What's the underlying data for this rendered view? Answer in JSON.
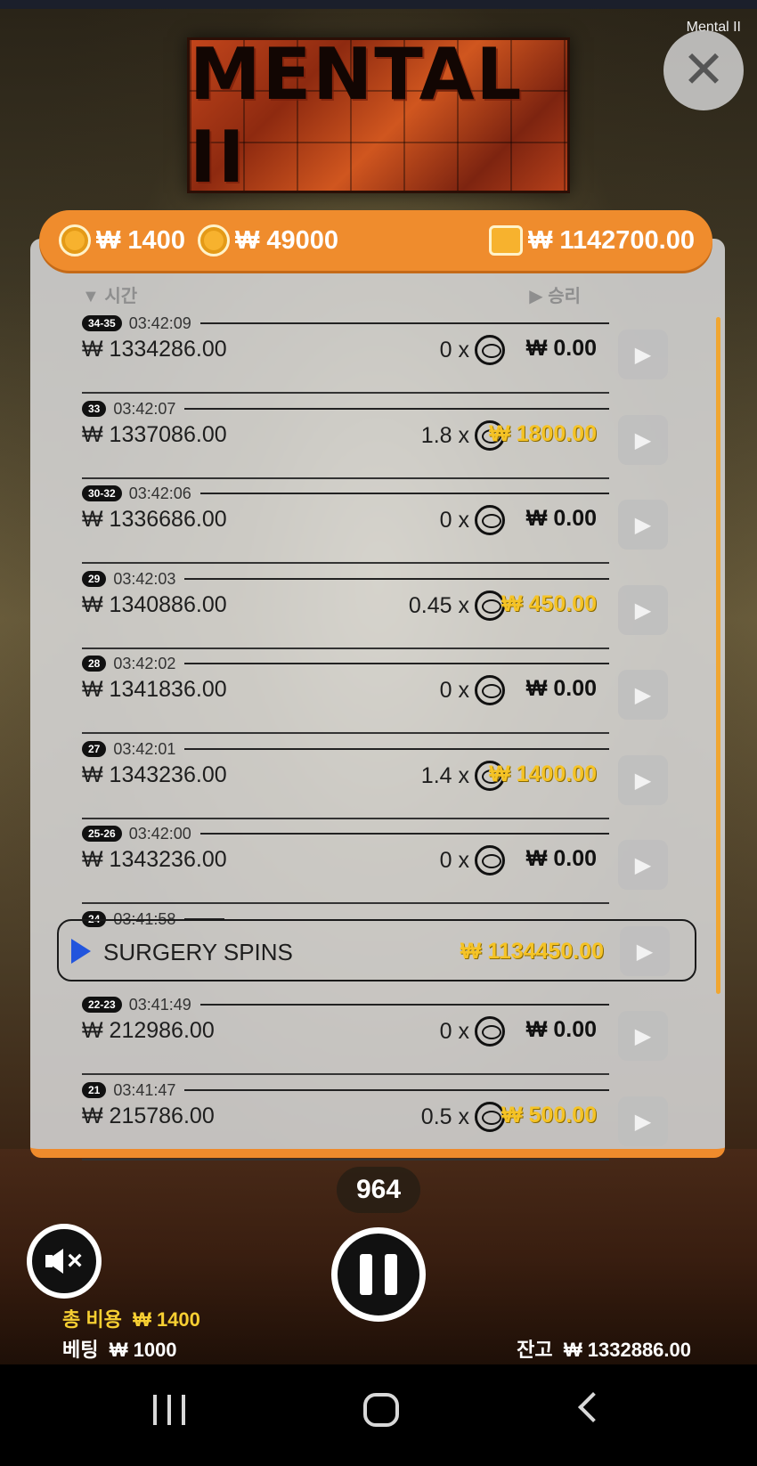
{
  "window_title": "Mental II",
  "logo_text": "MENTAL II",
  "header": {
    "bet_amount": "₩ 1400",
    "feature_cost": "₩ 49000",
    "wallet_balance": "₩ 1142700.00"
  },
  "columns": {
    "time": "▼ 시간",
    "win": "▶ 승리"
  },
  "rows": [
    {
      "badge": "34-35",
      "time": "03:42:09",
      "balance": "₩ 1334286.00",
      "mult": "0 x",
      "win": "₩ 0.00",
      "positive": false
    },
    {
      "badge": "33",
      "time": "03:42:07",
      "balance": "₩ 1337086.00",
      "mult": "1.8 x",
      "win": "₩ 1800.00",
      "positive": true
    },
    {
      "badge": "30-32",
      "time": "03:42:06",
      "balance": "₩ 1336686.00",
      "mult": "0 x",
      "win": "₩ 0.00",
      "positive": false
    },
    {
      "badge": "29",
      "time": "03:42:03",
      "balance": "₩ 1340886.00",
      "mult": "0.45 x",
      "win": "₩ 450.00",
      "positive": true
    },
    {
      "badge": "28",
      "time": "03:42:02",
      "balance": "₩ 1341836.00",
      "mult": "0 x",
      "win": "₩ 0.00",
      "positive": false
    },
    {
      "badge": "27",
      "time": "03:42:01",
      "balance": "₩ 1343236.00",
      "mult": "1.4 x",
      "win": "₩ 1400.00",
      "positive": true
    },
    {
      "badge": "25-26",
      "time": "03:42:00",
      "balance": "₩ 1343236.00",
      "mult": "0 x",
      "win": "₩ 0.00",
      "positive": false
    }
  ],
  "feature": {
    "badge": "24",
    "time": "03:41:58",
    "label": "SURGERY SPINS",
    "win": "₩ 1134450.00"
  },
  "rows_after": [
    {
      "badge": "22-23",
      "time": "03:41:49",
      "balance": "₩ 212986.00",
      "mult": "0 x",
      "win": "₩ 0.00",
      "positive": false
    },
    {
      "badge": "21",
      "time": "03:41:47",
      "balance": "₩ 215786.00",
      "mult": "0.5 x",
      "win": "₩ 500.00",
      "positive": true
    }
  ],
  "spin_counter": "964",
  "footer": {
    "total_cost_label": "총 비용",
    "total_cost_value": "₩ 1400",
    "bet_label": "베팅",
    "bet_value": "₩ 1000",
    "balance_label": "잔고",
    "balance_value": "₩ 1332886.00"
  },
  "colors": {
    "accent": "#ef8c2d",
    "win_positive": "#f5c326",
    "feature_arrow": "#2255dd"
  },
  "icons": {
    "close": "close-icon",
    "coin": "coin-icon",
    "wallet": "wallet-icon",
    "play": "play-icon",
    "mute": "speaker-muted-icon",
    "pause": "pause-icon"
  }
}
